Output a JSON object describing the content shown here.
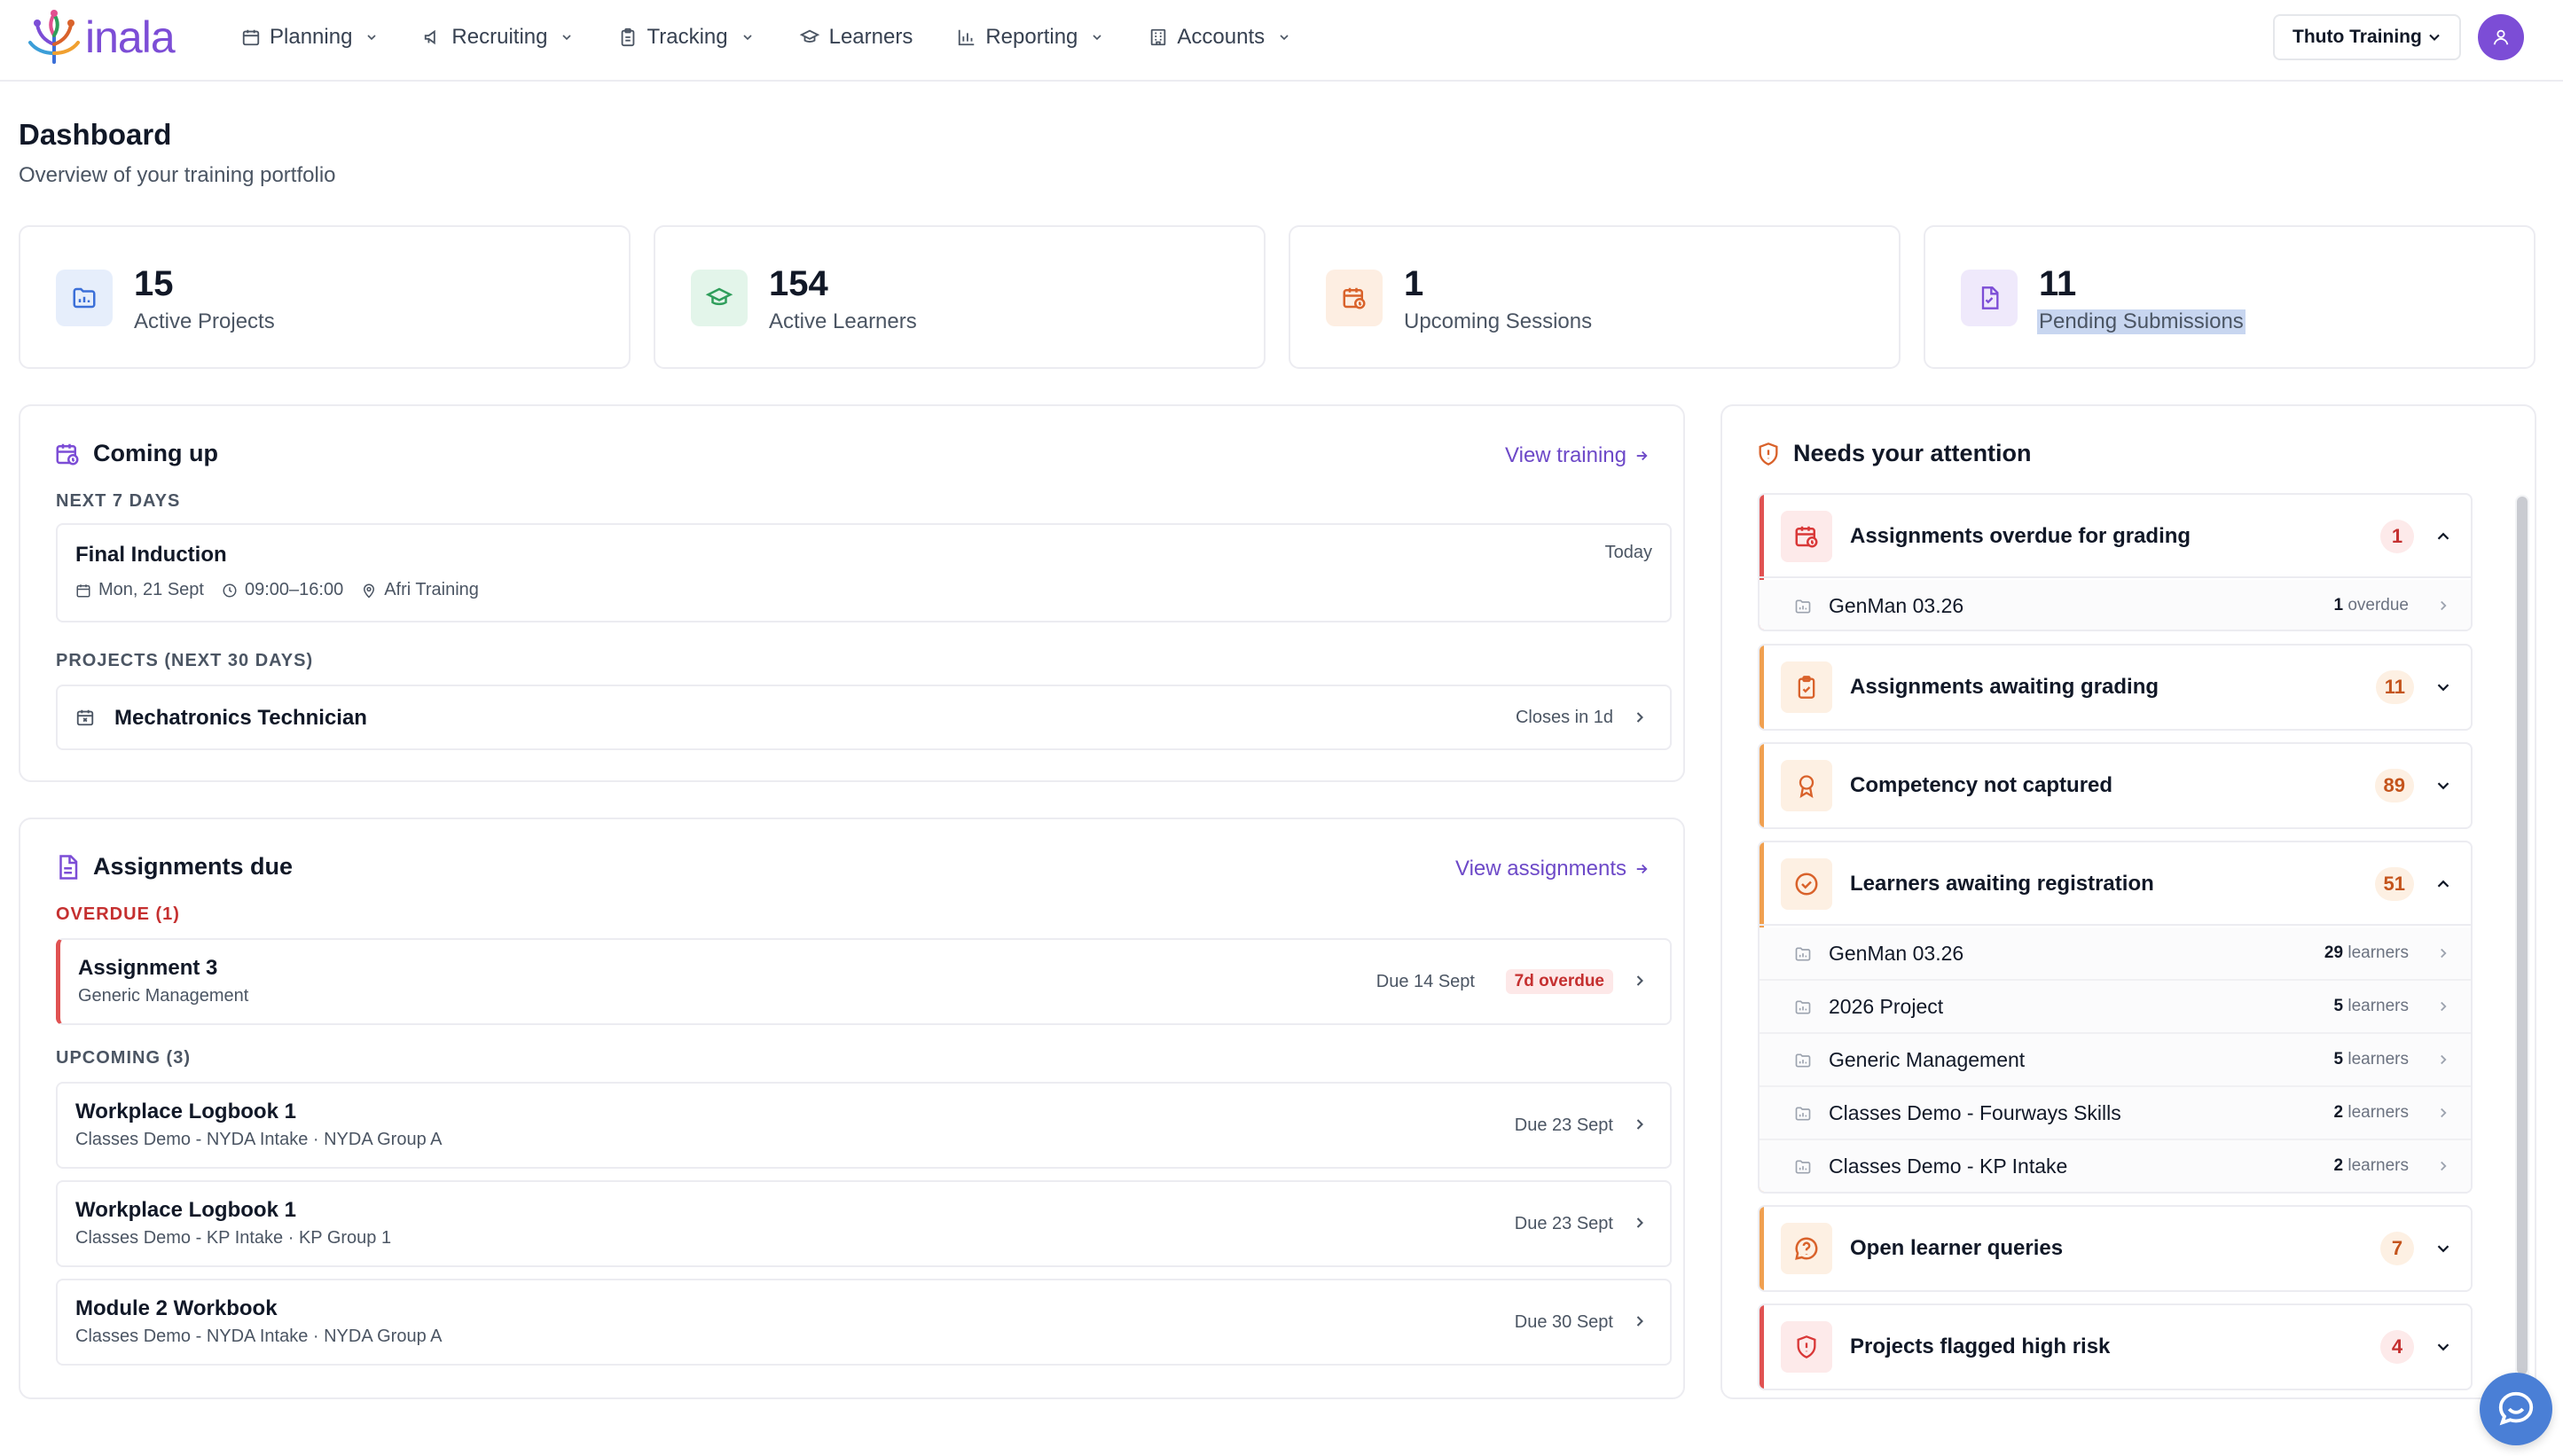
{
  "brand": {
    "name": "inala",
    "accent": "#7c4dd6"
  },
  "nav": {
    "items": [
      {
        "label": "Planning",
        "icon": "calendar-icon",
        "dropdown": true
      },
      {
        "label": "Recruiting",
        "icon": "megaphone-icon",
        "dropdown": true
      },
      {
        "label": "Tracking",
        "icon": "clipboard-icon",
        "dropdown": true
      },
      {
        "label": "Learners",
        "icon": "graduation-cap-icon",
        "dropdown": false
      },
      {
        "label": "Reporting",
        "icon": "bar-chart-icon",
        "dropdown": true
      },
      {
        "label": "Accounts",
        "icon": "building-icon",
        "dropdown": true
      }
    ],
    "org_selector": "Thuto Training"
  },
  "header": {
    "title": "Dashboard",
    "subtitle": "Overview of your training portfolio"
  },
  "stats": [
    {
      "value": "15",
      "label": "Active Projects",
      "icon": "folder-chart-icon",
      "color": "#3b6fd8",
      "bg": "#e6eefb"
    },
    {
      "value": "154",
      "label": "Active Learners",
      "icon": "graduation-cap-icon",
      "color": "#2f9e5b",
      "bg": "#e3f5ea"
    },
    {
      "value": "1",
      "label": "Upcoming Sessions",
      "icon": "calendar-clock-icon",
      "color": "#d9622b",
      "bg": "#fdeee2"
    },
    {
      "value": "11",
      "label": "Pending Submissions",
      "icon": "file-check-icon",
      "color": "#7c4dd6",
      "bg": "#efe9fb"
    }
  ],
  "coming_up": {
    "title": "Coming up",
    "link": "View training",
    "next7_label": "NEXT 7 DAYS",
    "event": {
      "title": "Final Induction",
      "badge": "Today",
      "date": "Mon, 21 Sept",
      "time": "09:00–16:00",
      "location": "Afri Training"
    },
    "projects_label": "PROJECTS (NEXT 30 DAYS)",
    "project": {
      "title": "Mechatronics Technician",
      "status": "Closes in 1d"
    }
  },
  "assignments": {
    "title": "Assignments due",
    "link": "View assignments",
    "overdue_label": "OVERDUE (1)",
    "overdue": [
      {
        "title": "Assignment 3",
        "sub": "Generic Management",
        "due": "Due 14 Sept",
        "badge": "7d overdue"
      }
    ],
    "upcoming_label": "UPCOMING (3)",
    "upcoming": [
      {
        "title": "Workplace Logbook 1",
        "sub": "Classes Demo - NYDA Intake · NYDA Group A",
        "due": "Due 23 Sept"
      },
      {
        "title": "Workplace Logbook 1",
        "sub": "Classes Demo - KP Intake · KP Group 1",
        "due": "Due 23 Sept"
      },
      {
        "title": "Module 2 Workbook",
        "sub": "Classes Demo - NYDA Intake · NYDA Group A",
        "due": "Due 30 Sept"
      }
    ]
  },
  "attention": {
    "title": "Needs your attention",
    "items": [
      {
        "title": "Assignments overdue for grading",
        "count": "1",
        "tone": "red",
        "expanded": true,
        "rows": [
          {
            "name": "GenMan 03.26",
            "num": "1",
            "unit": "overdue"
          }
        ]
      },
      {
        "title": "Assignments awaiting grading",
        "count": "11",
        "tone": "orange",
        "expanded": false,
        "rows": []
      },
      {
        "title": "Competency not captured",
        "count": "89",
        "tone": "orange",
        "expanded": false,
        "rows": []
      },
      {
        "title": "Learners awaiting registration",
        "count": "51",
        "tone": "orange",
        "expanded": true,
        "rows": [
          {
            "name": "GenMan 03.26",
            "num": "29",
            "unit": "learners"
          },
          {
            "name": "2026 Project",
            "num": "5",
            "unit": "learners"
          },
          {
            "name": "Generic Management",
            "num": "5",
            "unit": "learners"
          },
          {
            "name": "Classes Demo - Fourways Skills",
            "num": "2",
            "unit": "learners"
          },
          {
            "name": "Classes Demo - KP Intake",
            "num": "2",
            "unit": "learners"
          }
        ]
      },
      {
        "title": "Open learner queries",
        "count": "7",
        "tone": "orange",
        "expanded": false,
        "rows": []
      },
      {
        "title": "Projects flagged high risk",
        "count": "4",
        "tone": "red",
        "expanded": false,
        "rows": []
      }
    ]
  },
  "colors": {
    "red": "#e05252",
    "red_bg": "#fdeaea",
    "orange": "#f0a050",
    "orange_bg": "#fdf0e3",
    "link": "#6d49c8"
  }
}
